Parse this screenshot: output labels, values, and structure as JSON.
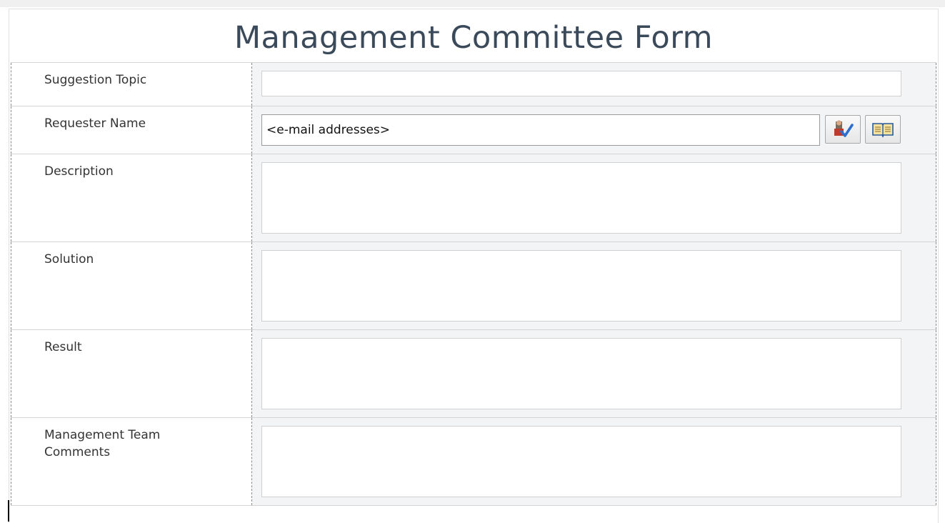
{
  "form": {
    "title": "Management Committee Form"
  },
  "fields": {
    "suggestion_topic": {
      "label": "Suggestion Topic",
      "value": ""
    },
    "requester_name": {
      "label": "Requester Name",
      "value": "<e-mail addresses>",
      "check_names_icon": "check-names-icon",
      "browse_icon": "address-book-icon"
    },
    "description": {
      "label": "Description",
      "value": ""
    },
    "solution": {
      "label": "Solution",
      "value": ""
    },
    "result": {
      "label": "Result",
      "value": ""
    },
    "management_team_comments": {
      "label": "Management Team Comments",
      "value": ""
    }
  },
  "colors": {
    "title_text": "#3a4a5a",
    "input_cell_bg": "#f3f4f6",
    "check_icon_blue": "#2a6fd0",
    "person_icon_red": "#c0392b"
  }
}
